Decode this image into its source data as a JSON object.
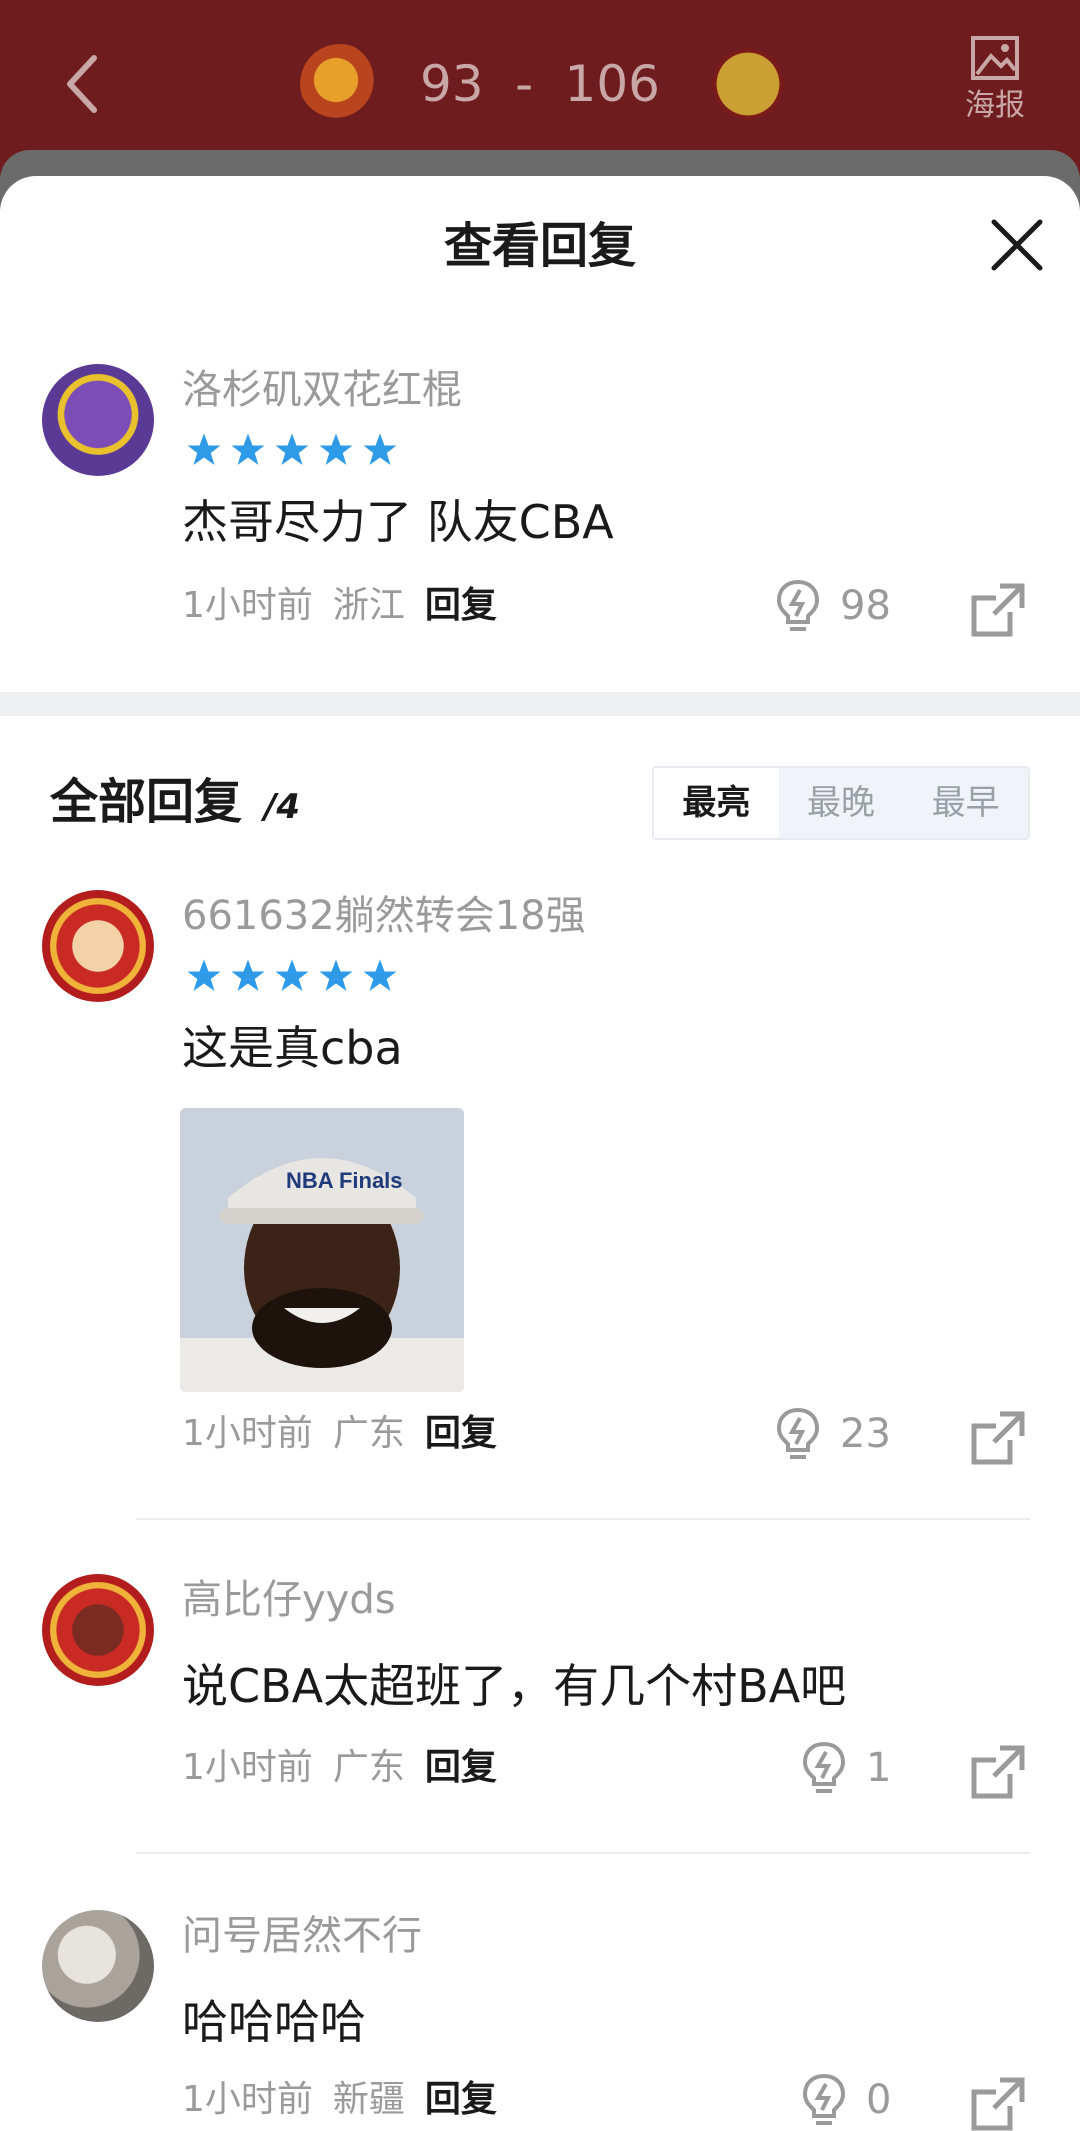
{
  "header": {
    "score_home": "93",
    "score_sep": "-",
    "score_away": "106",
    "poster_label": "海报"
  },
  "sheet": {
    "title": "查看回复"
  },
  "main_comment": {
    "user": "洛杉矶双花红棍",
    "rating_stars": 5,
    "text": "杰哥尽力了 队友CBA",
    "time": "1小时前",
    "location": "浙江",
    "reply_label": "回复",
    "likes": "98"
  },
  "replies_section": {
    "title": "全部回复",
    "count": "/4",
    "sort_tabs": [
      "最亮",
      "最晚",
      "最早"
    ],
    "active_tab": "最亮"
  },
  "replies": [
    {
      "user": "661632躺然转会18强",
      "rating_stars": 5,
      "text": "这是真cba",
      "time": "1小时前",
      "location": "广东",
      "reply_label": "回复",
      "likes": "23",
      "image_caption": "NBA Finals"
    },
    {
      "user": "高比仔yyds",
      "text": "说CBA太超班了，有几个村BA吧",
      "time": "1小时前",
      "location": "广东",
      "reply_label": "回复",
      "likes": "1"
    },
    {
      "user": "问号居然不行",
      "text": "哈哈哈哈",
      "time": "1小时前",
      "location": "新疆",
      "reply_label": "回复",
      "likes": "0"
    }
  ],
  "colors": {
    "header_bg": "#6e1c1e",
    "star_blue": "#2f9be8",
    "muted_text": "#9a9a9a",
    "body_text": "#1a1a1a"
  },
  "icons": [
    "back-arrow-icon",
    "poster-icon",
    "close-icon",
    "star-icon",
    "lightbulb-icon",
    "share-icon"
  ]
}
